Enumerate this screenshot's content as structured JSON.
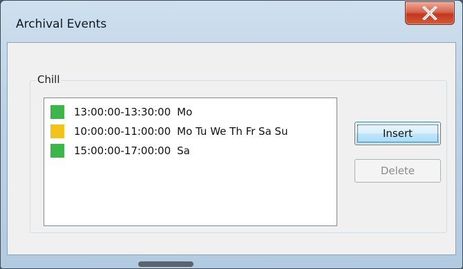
{
  "window": {
    "title": "Archival Events",
    "close_symbol": "x"
  },
  "group": {
    "label": "Chill"
  },
  "events": [
    {
      "time": "13:00:00-13:30:00",
      "days": "Mo",
      "color": "#3cb54a"
    },
    {
      "time": "10:00:00-11:00:00",
      "days": "Mo Tu We Th Fr Sa Su",
      "color": "#f2c318"
    },
    {
      "time": "15:00:00-17:00:00",
      "days": "Sa",
      "color": "#3cb54a"
    }
  ],
  "buttons": {
    "insert_label": "Insert",
    "delete_label": "Delete",
    "delete_enabled": false
  },
  "icons": {
    "close": "close-icon"
  }
}
